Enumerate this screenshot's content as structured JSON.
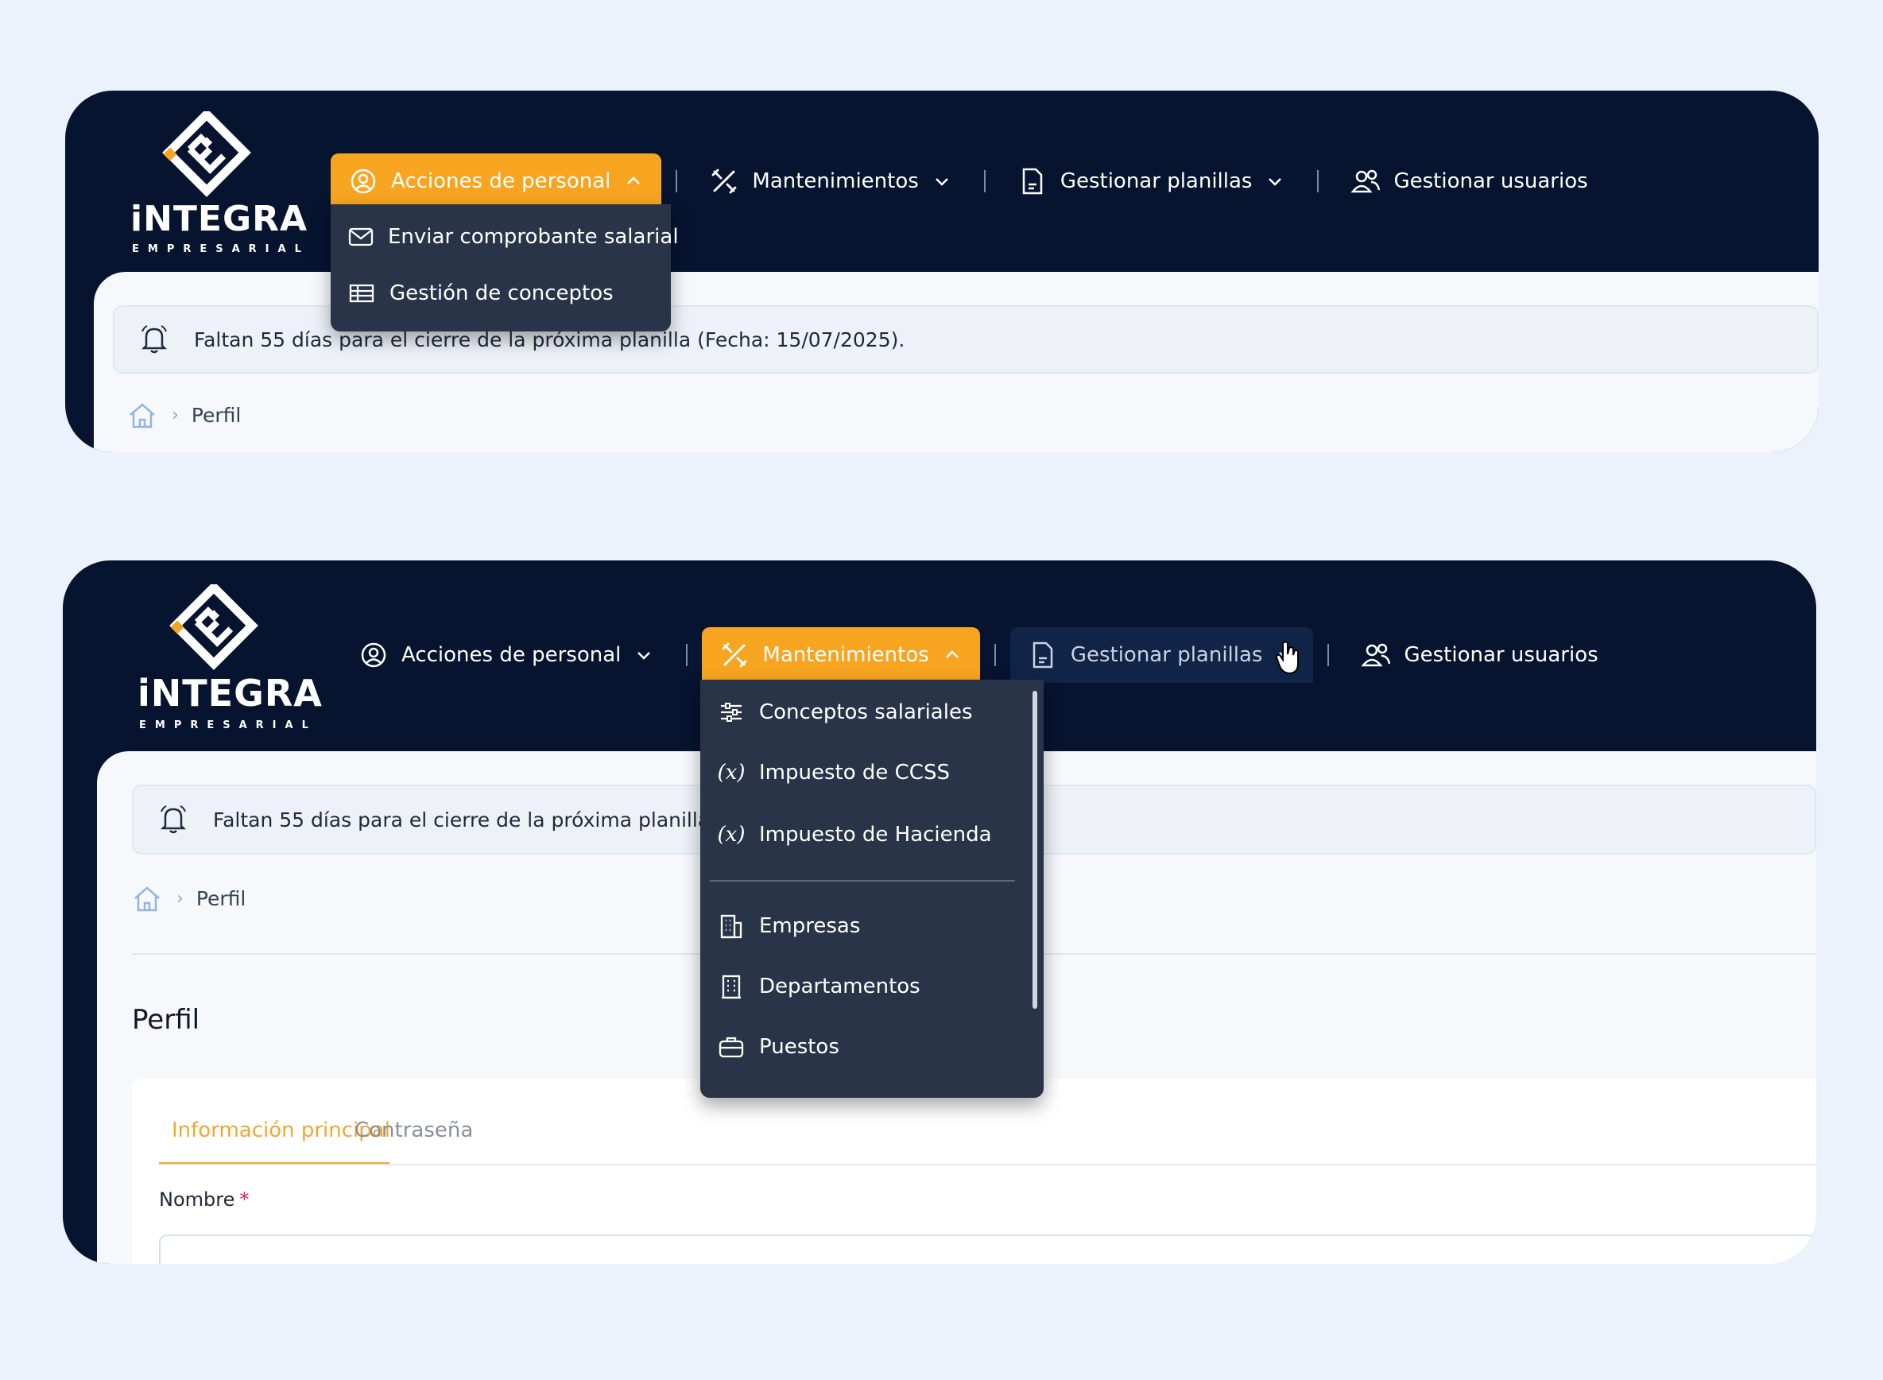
{
  "brand": {
    "title": "iNTEGRA",
    "subtitle": "EMPRESARIAL"
  },
  "colors": {
    "nav_bg": "#061430",
    "accent": "#f7a521",
    "dropdown_bg": "#2a3449",
    "content_bg": "#f6f8fc",
    "page_bg": "#ecf2fb"
  },
  "nav": {
    "acciones": "Acciones de personal",
    "mantenimientos": "Mantenimientos",
    "planillas": "Gestionar planillas",
    "usuarios": "Gestionar usuarios"
  },
  "top_panel": {
    "dropdown": [
      {
        "label": "Enviar comprobante salarial",
        "icon": "mail-icon"
      },
      {
        "label": "Gestión de conceptos",
        "icon": "table-icon"
      }
    ],
    "alert": "Faltan 55 días para el cierre de la próxima planilla (Fecha: 15/07/2025).",
    "breadcrumb": "Perfil"
  },
  "bottom_panel": {
    "dropdown_group1": [
      {
        "label": "Conceptos salariales",
        "icon": "sliders-icon"
      },
      {
        "label": "Impuesto de CCSS",
        "icon": "function-icon"
      },
      {
        "label": "Impuesto de Hacienda",
        "icon": "function-icon"
      }
    ],
    "dropdown_group2": [
      {
        "label": "Empresas",
        "icon": "building-icon"
      },
      {
        "label": "Departamentos",
        "icon": "office-icon"
      },
      {
        "label": "Puestos",
        "icon": "briefcase-icon"
      }
    ],
    "alert": "Faltan 55 días para el cierre de la próxima planilla",
    "breadcrumb": "Perfil",
    "page_title": "Perfil",
    "tabs": [
      "Información principal",
      "Contraseña"
    ],
    "field_label": "Nombre",
    "required_mark": "*"
  }
}
